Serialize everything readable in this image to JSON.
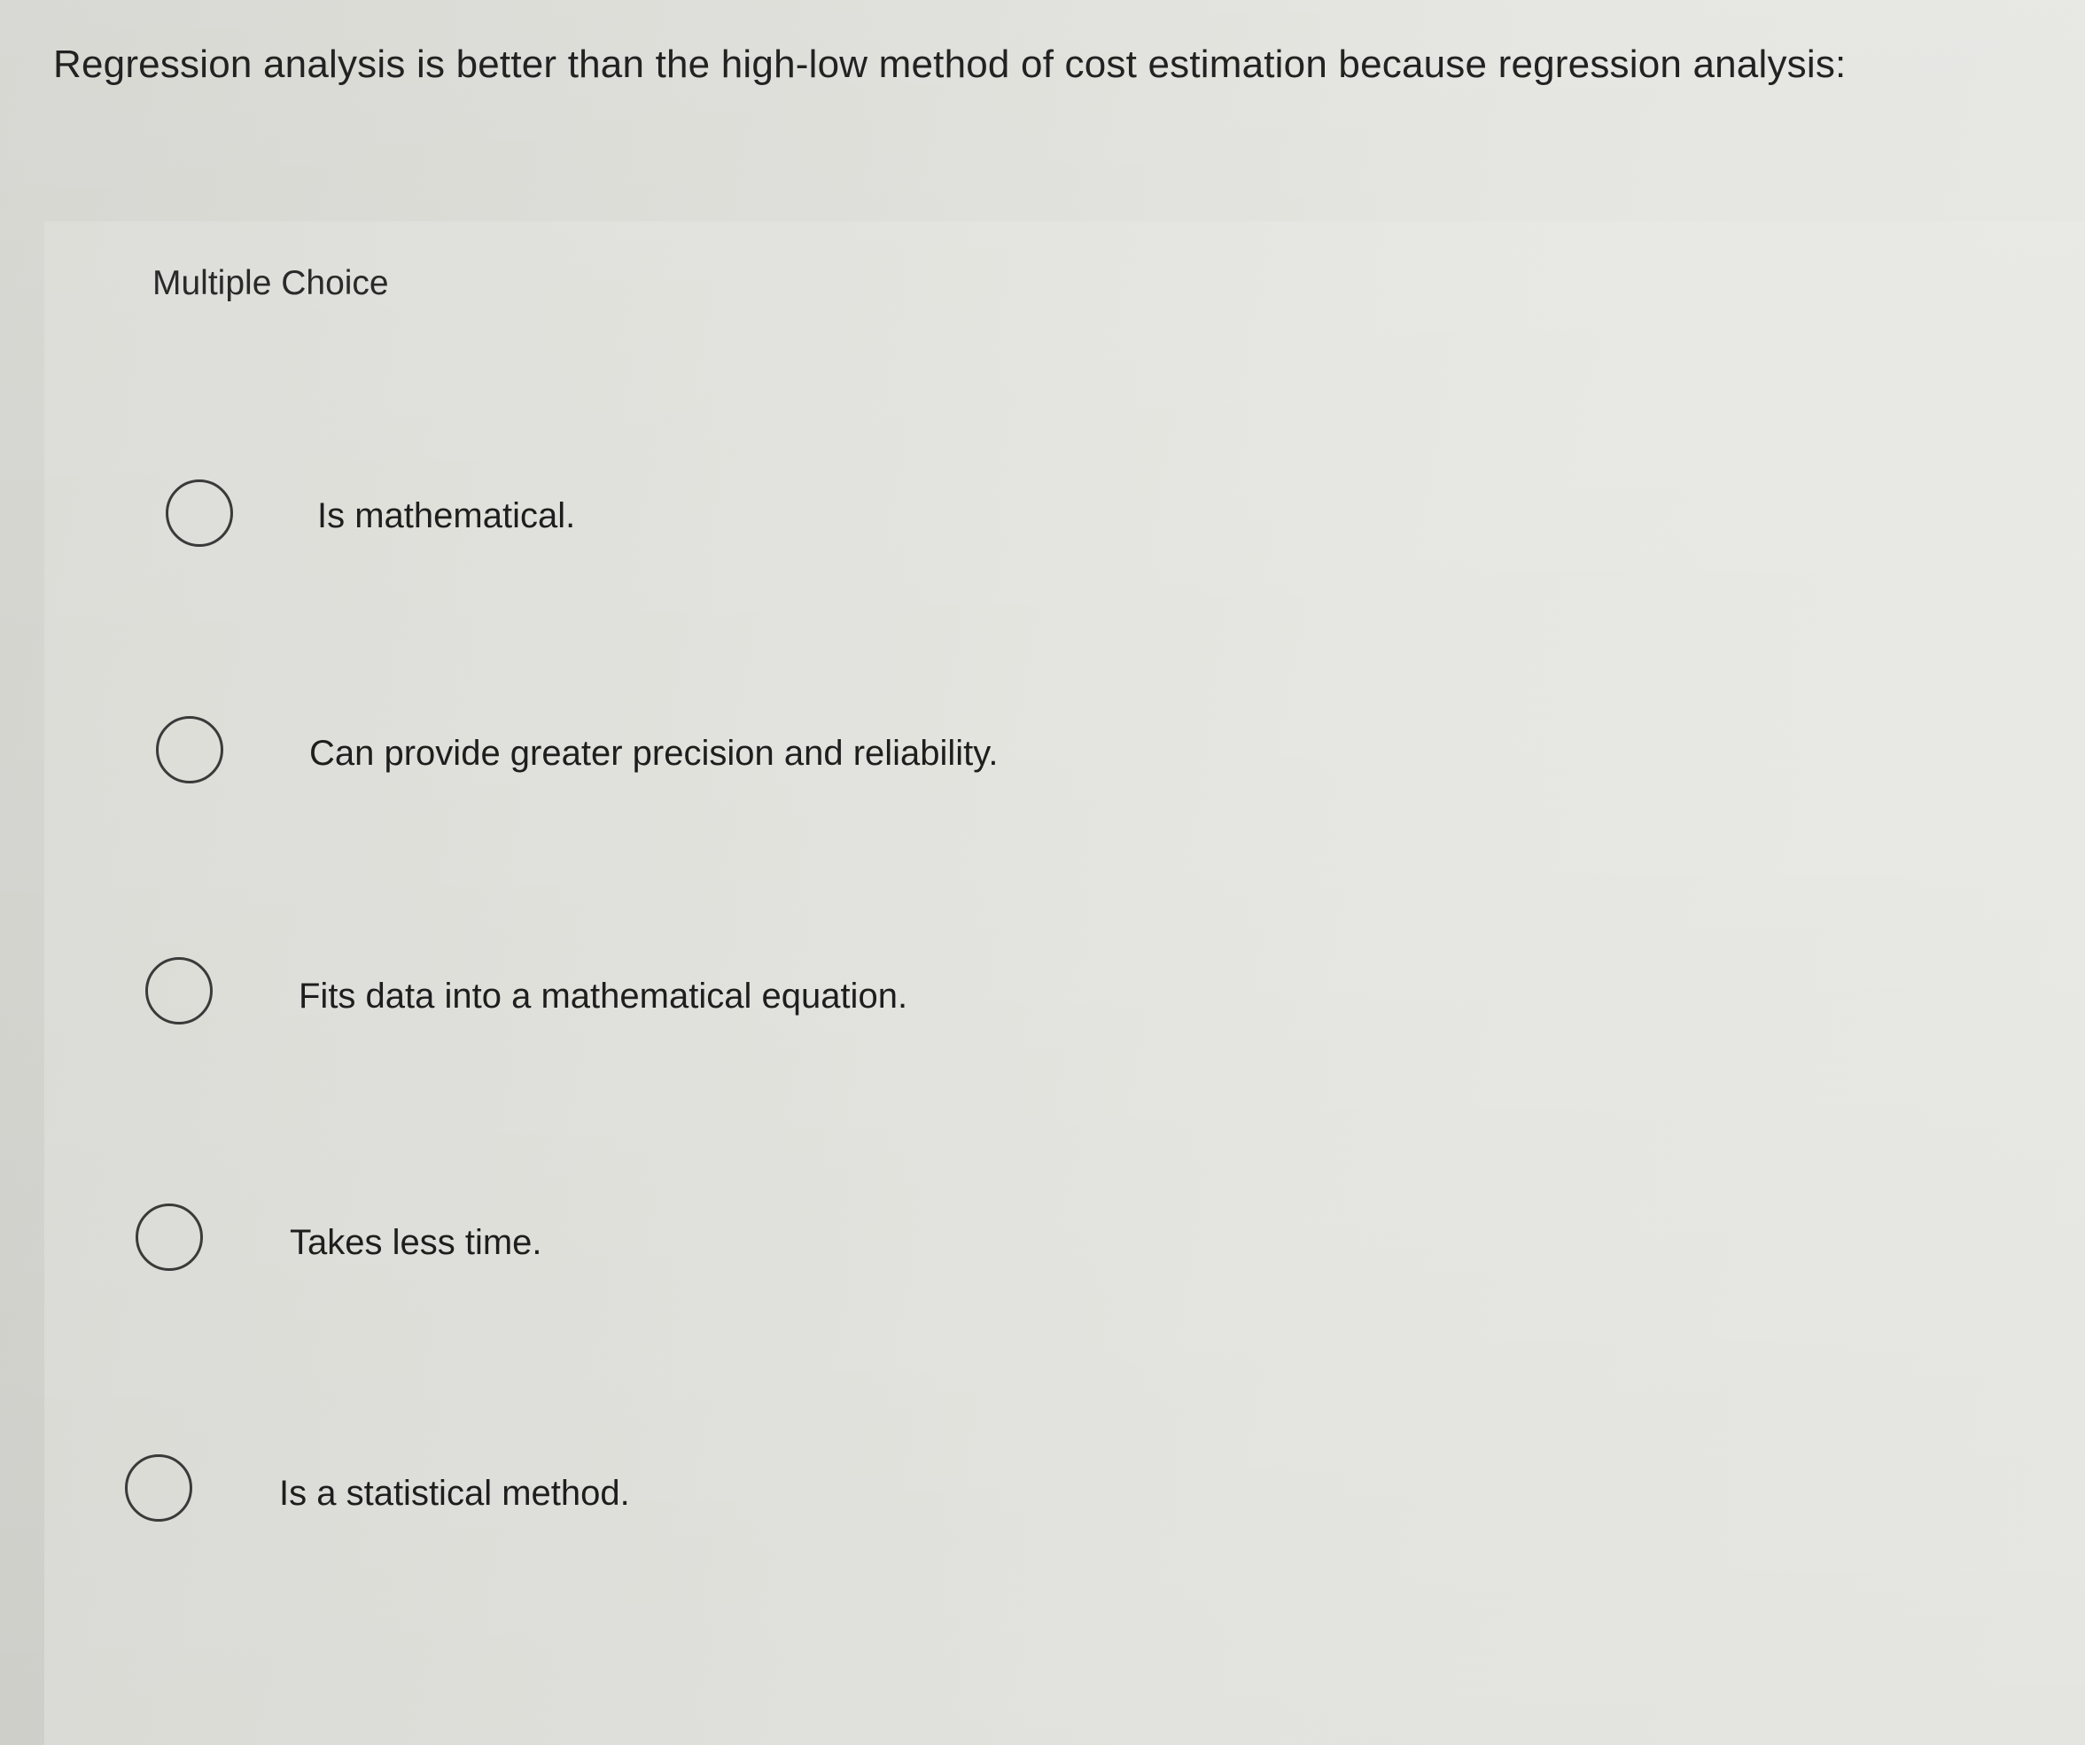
{
  "question": {
    "text": "Regression analysis is better than the high-low method of cost estimation because regression analysis:"
  },
  "quiz": {
    "type_label": "Multiple Choice",
    "options": [
      {
        "label": "Is mathematical.",
        "selected": false
      },
      {
        "label": "Can provide greater precision and reliability.",
        "selected": false
      },
      {
        "label": "Fits data into a mathematical equation.",
        "selected": false
      },
      {
        "label": "Takes less time.",
        "selected": false
      },
      {
        "label": "Is a statistical method.",
        "selected": false
      }
    ]
  }
}
